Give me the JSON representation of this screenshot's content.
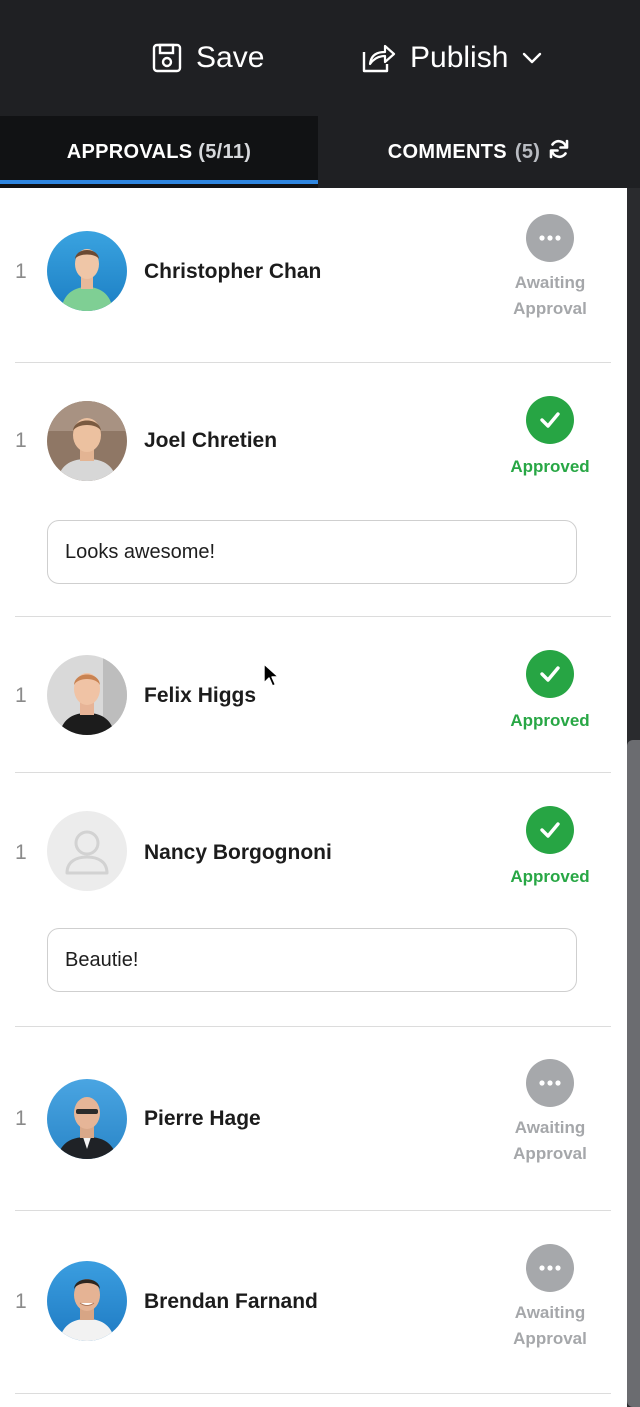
{
  "toolbar": {
    "save_label": "Save",
    "publish_label": "Publish"
  },
  "tabs": {
    "approvals": {
      "label": "APPROVALS",
      "count": "(5/11)",
      "active": true
    },
    "comments": {
      "label": "COMMENTS",
      "count": "(5)"
    }
  },
  "approvals": [
    {
      "index": "1",
      "name": "Christopher Chan",
      "status": "awaiting",
      "status_line1": "Awaiting",
      "status_line2": "Approval",
      "comment": ""
    },
    {
      "index": "1",
      "name": "Joel Chretien",
      "status": "approved",
      "status_line1": "Approved",
      "status_line2": "",
      "comment": "Looks awesome!"
    },
    {
      "index": "1",
      "name": "Felix Higgs",
      "status": "approved",
      "status_line1": "Approved",
      "status_line2": "",
      "comment": ""
    },
    {
      "index": "1",
      "name": "Nancy Borgognoni",
      "status": "approved",
      "status_line1": "Approved",
      "status_line2": "",
      "comment": "Beautie!"
    },
    {
      "index": "1",
      "name": "Pierre Hage",
      "status": "awaiting",
      "status_line1": "Awaiting",
      "status_line2": "Approval",
      "comment": ""
    },
    {
      "index": "1",
      "name": "Brendan Farnand",
      "status": "awaiting",
      "status_line1": "Awaiting",
      "status_line2": "Approval",
      "comment": ""
    }
  ],
  "colors": {
    "topbar_bg": "#1f2023",
    "active_tab_underline": "#2f86e0",
    "approved_green": "#28a745",
    "awaiting_gray": "#a6a8ab"
  },
  "icons": {
    "save": "floppy-disk-icon",
    "publish": "share-arrow-icon",
    "dropdown": "chevron-down-icon",
    "refresh": "refresh-icon",
    "approved": "checkmark-icon",
    "awaiting": "ellipsis-icon"
  }
}
